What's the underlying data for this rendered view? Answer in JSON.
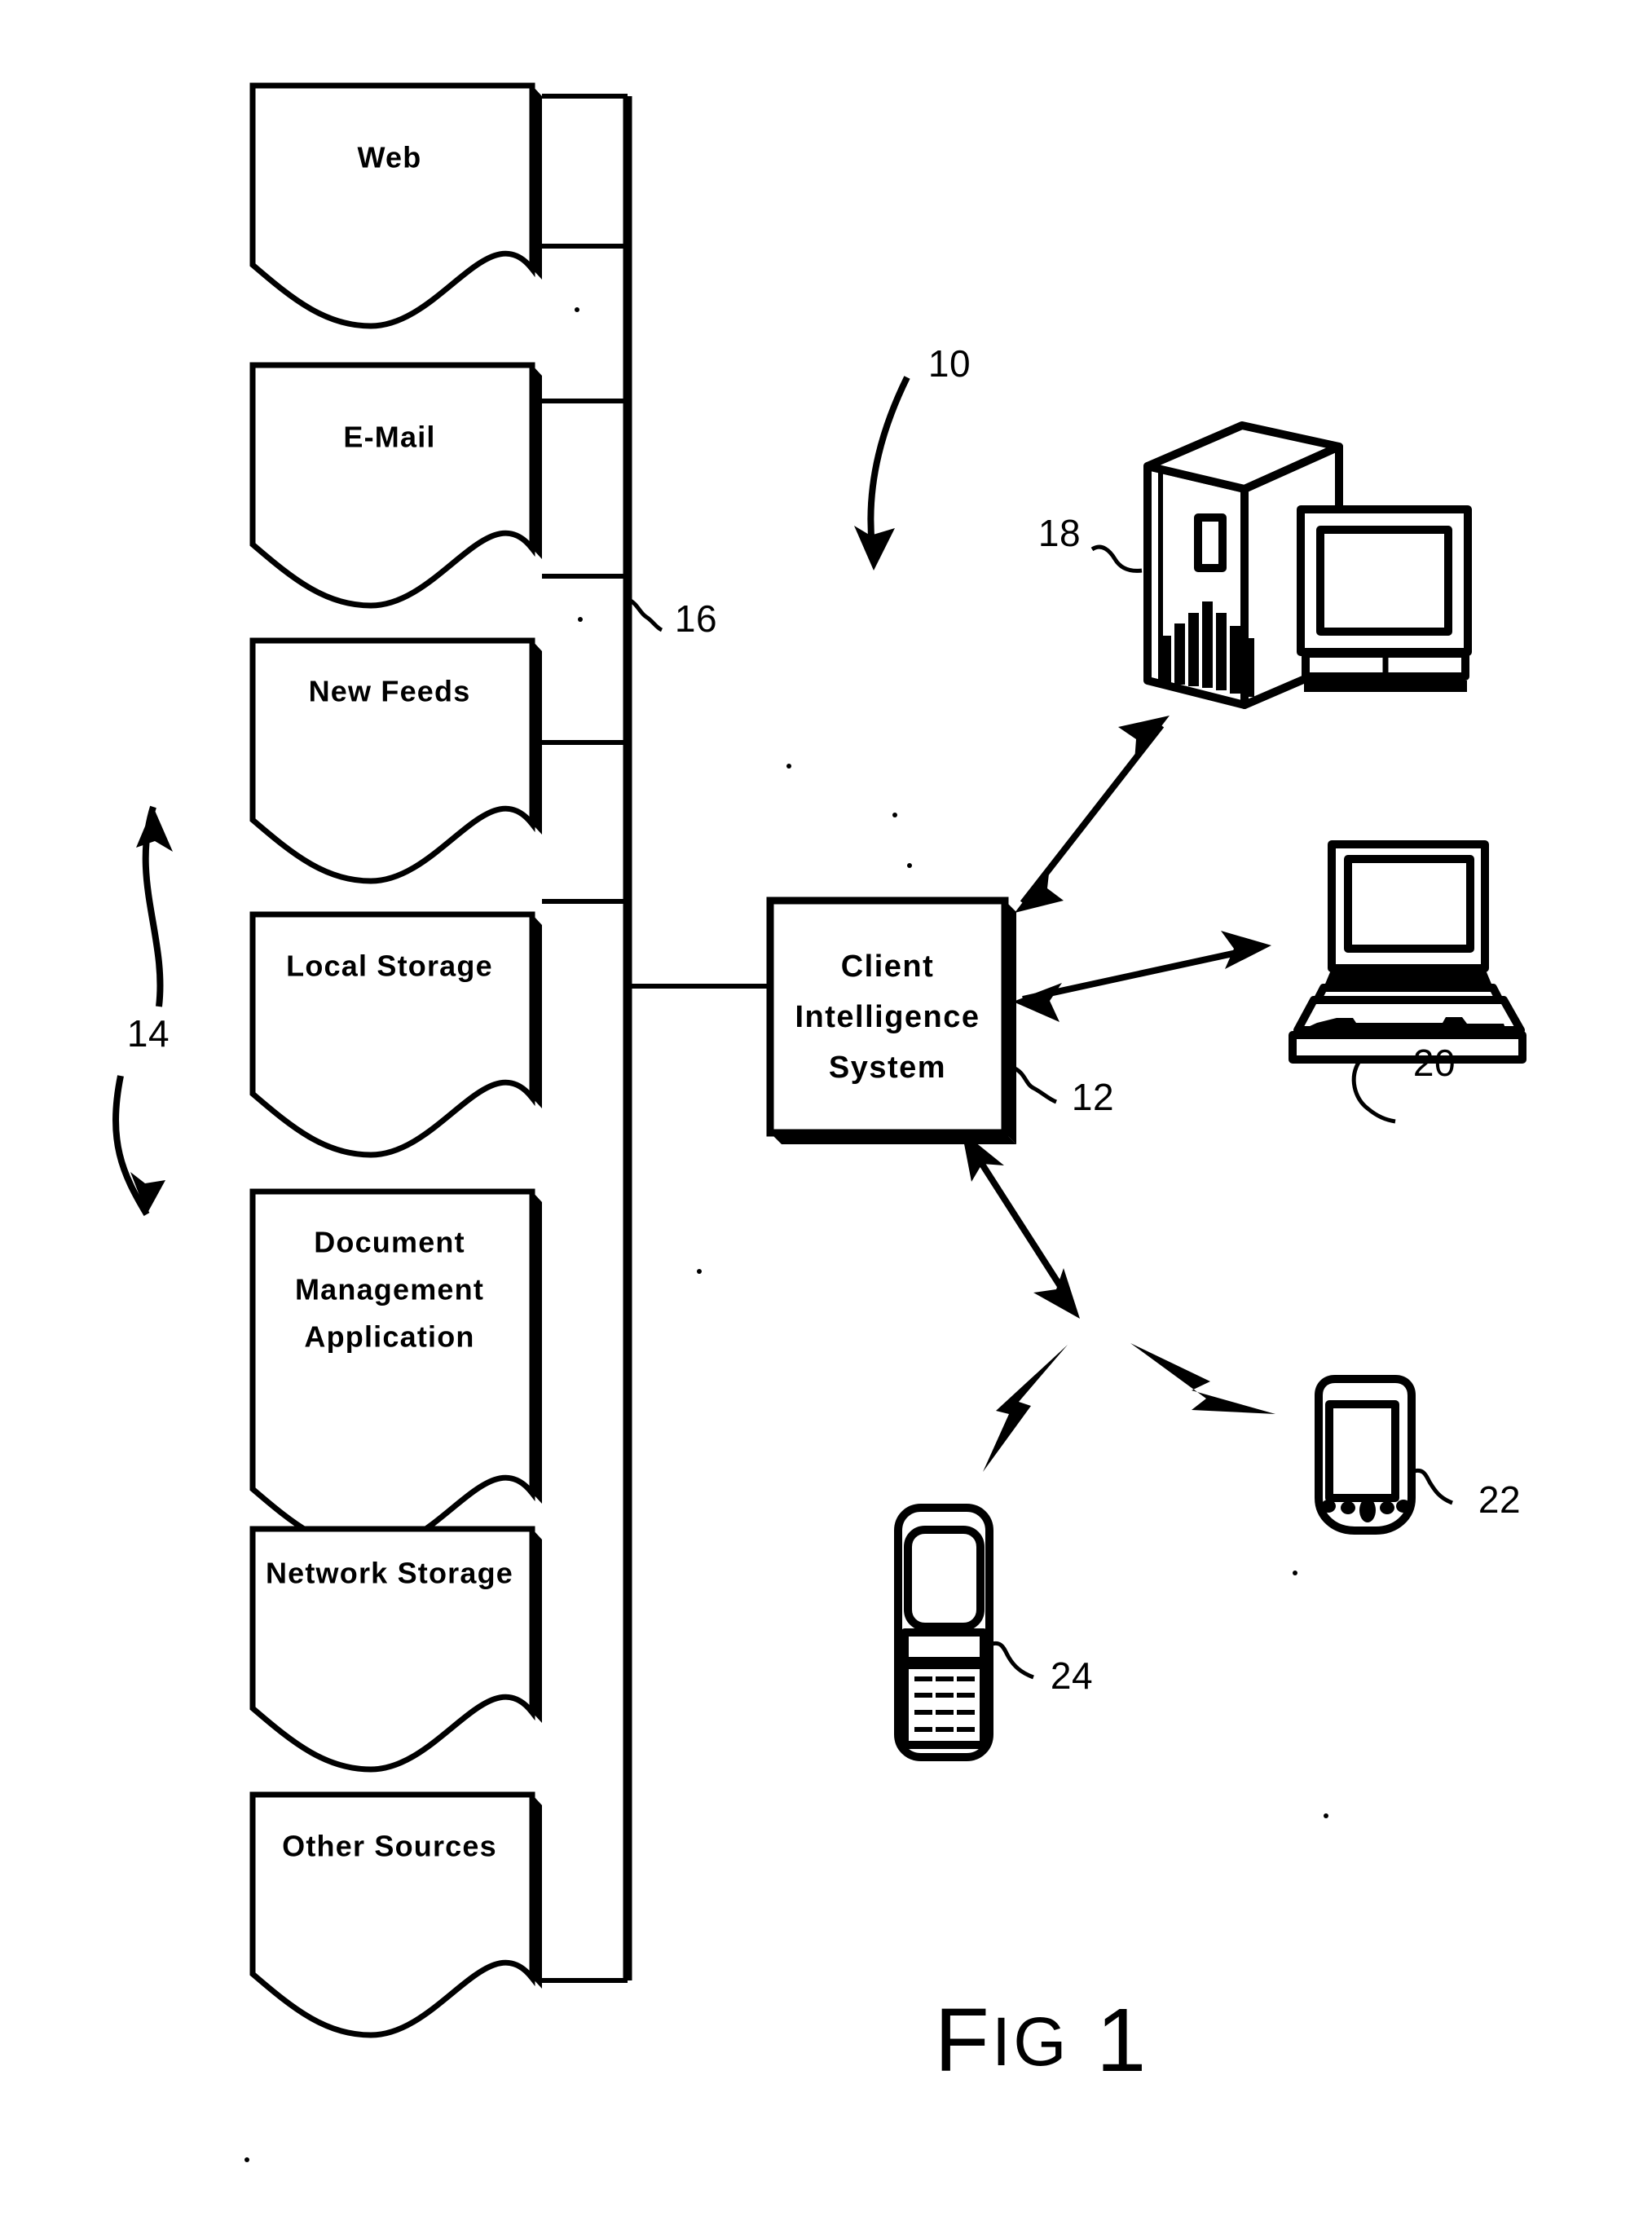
{
  "figure": {
    "title": "Fig 1",
    "title_parts": {
      "big1": "F",
      "small1": "IG",
      "big2": " 1"
    }
  },
  "sources": {
    "group_ref": "14",
    "bus_ref": "16",
    "items": [
      {
        "id": "web",
        "label": "Web",
        "lines": [
          "Web"
        ]
      },
      {
        "id": "email",
        "label": "E-Mail",
        "lines": [
          "E-Mail"
        ]
      },
      {
        "id": "new-feeds",
        "label": "New Feeds",
        "lines": [
          "New Feeds"
        ]
      },
      {
        "id": "local-storage",
        "label": "Local Storage",
        "lines": [
          "Local Storage"
        ]
      },
      {
        "id": "document-management-application",
        "label": "Document Management Application",
        "lines": [
          "Document",
          "Management",
          "Application"
        ]
      },
      {
        "id": "network-storage",
        "label": "Network Storage",
        "lines": [
          "Network Storage"
        ]
      },
      {
        "id": "other-sources",
        "label": "Other Sources",
        "lines": [
          "Other Sources"
        ]
      }
    ]
  },
  "system": {
    "overall_ref": "10",
    "box_ref": "12",
    "box_lines": [
      "Client",
      "Intelligence",
      "System"
    ],
    "box_label": "Client Intelligence System"
  },
  "clients": [
    {
      "id": "desktop-computer",
      "ref": "18",
      "name": "Desktop computer and monitor",
      "link": "arrow-bidirectional"
    },
    {
      "id": "laptop-computer",
      "ref": "20",
      "name": "Laptop computer",
      "link": "arrow-bidirectional"
    },
    {
      "id": "pda-device",
      "ref": "22",
      "name": "PDA handheld device",
      "link": "wireless-lightning"
    },
    {
      "id": "mobile-phone",
      "ref": "24",
      "name": "Mobile phone",
      "link": "wireless-lightning"
    }
  ],
  "colors": {
    "ink": "#000000",
    "paper": "#ffffff"
  }
}
